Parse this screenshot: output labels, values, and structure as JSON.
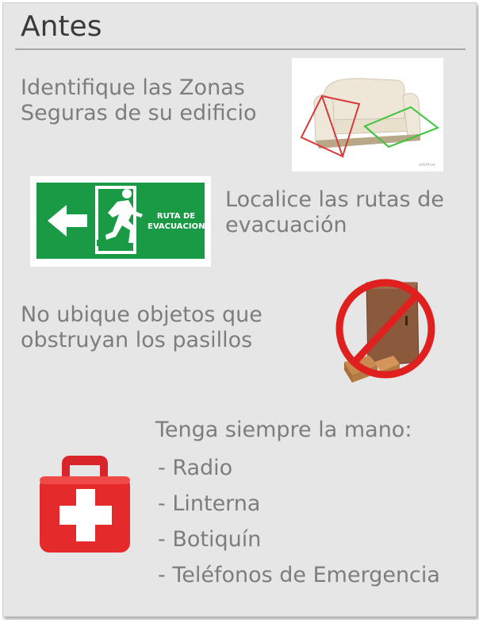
{
  "header": {
    "title": "Antes"
  },
  "items": [
    {
      "lines": [
        "Identifique las Zonas",
        "Seguras de su edificio"
      ],
      "icon": "sofa-safe-zone-icon"
    },
    {
      "lines": [
        "Localice las rutas de",
        "evacuación"
      ],
      "icon": "evacuation-route-sign-icon",
      "sign_text": [
        "RUTA DE",
        "EVACUACION"
      ]
    },
    {
      "lines": [
        "No ubique objetos que",
        "obstruyan los pasillos"
      ],
      "icon": "no-obstruction-icon"
    }
  ],
  "kit": {
    "heading": "Tenga  siempre la mano:",
    "list": [
      "- Radio",
      "- Linterna",
      "- Botiquín",
      "- Teléfonos de Emergencia"
    ],
    "icon": "first-aid-kit-icon"
  },
  "colors": {
    "background": "#e6e6e6",
    "sign_green": "#1a9a45",
    "prohibited_red": "#e0201e",
    "kit_red": "#e42a2a"
  }
}
